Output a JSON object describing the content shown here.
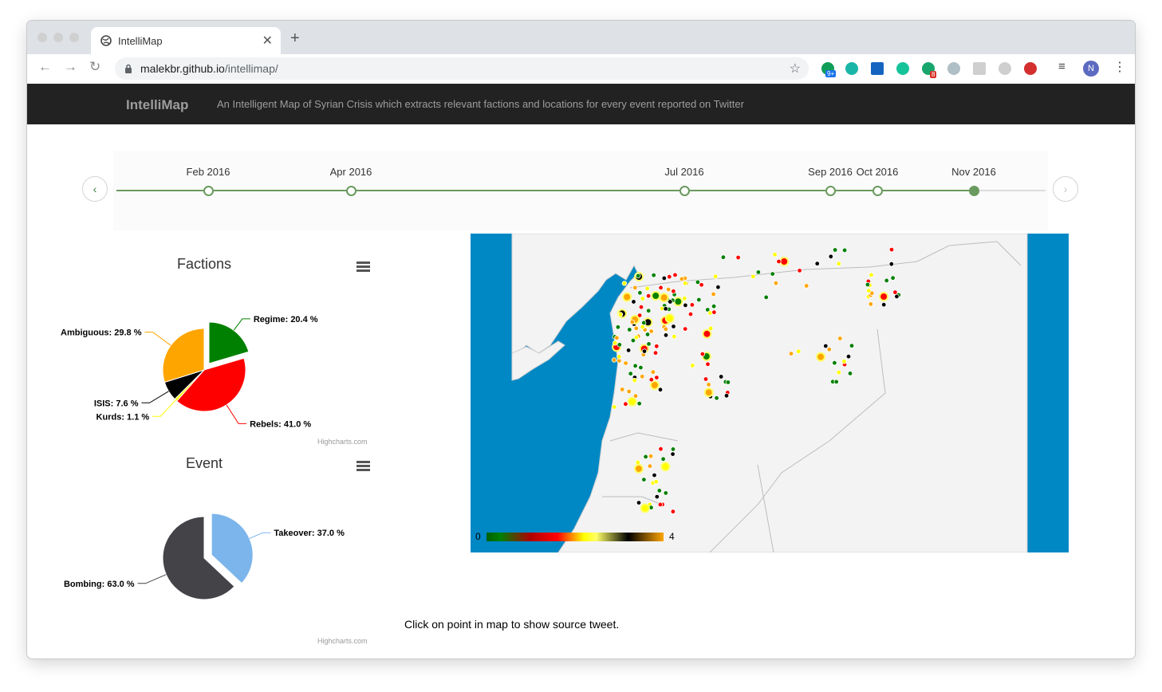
{
  "browser": {
    "tab_title": "IntelliMap",
    "url_host": "malekbr.github.io",
    "url_path": "/intellimap/",
    "ext_badge_1": "9+",
    "ext_badge_2": "8",
    "profile_initial": "N"
  },
  "header": {
    "brand": "IntelliMap",
    "tagline": "An Intelligent Map of Syrian Crisis which extracts relevant factions and locations for every event reported on Twitter"
  },
  "timeline": {
    "labels": [
      "Feb 2016",
      "Apr 2016",
      "Jul 2016",
      "Sep 2016",
      "Oct 2016",
      "Nov 2016"
    ],
    "selected": "Nov 2016"
  },
  "chart_data": [
    {
      "type": "pie",
      "title": "Factions",
      "slices": [
        {
          "name": "Regime",
          "value": 20.4,
          "color": "#008000",
          "label": "Regime: 20.4 %"
        },
        {
          "name": "Rebels",
          "value": 41.0,
          "color": "#ff0000",
          "label": "Rebels: 41.0 %"
        },
        {
          "name": "Kurds",
          "value": 1.1,
          "color": "#ffff00",
          "label": "Kurds: 1.1 %"
        },
        {
          "name": "ISIS",
          "value": 7.6,
          "color": "#000000",
          "label": "ISIS: 7.6 %"
        },
        {
          "name": "Ambiguous",
          "value": 29.8,
          "color": "#ffa500",
          "label": "Ambiguous: 29.8 %"
        }
      ],
      "credit": "Highcharts.com"
    },
    {
      "type": "pie",
      "title": "Event",
      "slices": [
        {
          "name": "Takeover",
          "value": 37.0,
          "color": "#7cb5ec",
          "label": "Takeover: 37.0 %"
        },
        {
          "name": "Bombing",
          "value": 63.0,
          "color": "#434348",
          "label": "Bombing: 63.0 %"
        }
      ],
      "credit": "Highcharts.com"
    }
  ],
  "map": {
    "legend_min": "0",
    "legend_max": "4",
    "sea_color": "#0088c4",
    "land_color": "#f3f3f3"
  },
  "footer": {
    "message": "Click on point in map to show source tweet."
  }
}
